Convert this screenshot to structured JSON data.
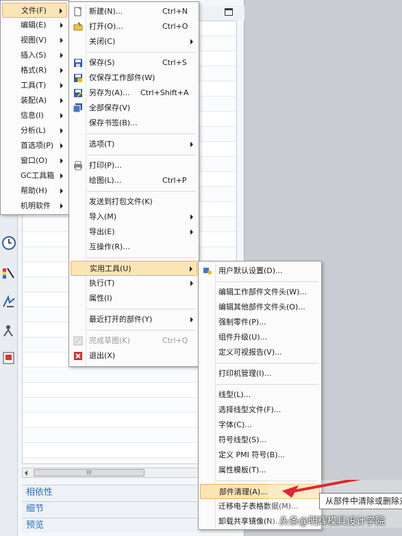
{
  "nav_panel": {
    "bottom_panels": [
      "相依性",
      "细节",
      "预览"
    ],
    "scroll_thumb": "III"
  },
  "main_menu": [
    {
      "label": "文件(F)",
      "active": true
    },
    {
      "label": "编辑(E)"
    },
    {
      "label": "视图(V)"
    },
    {
      "label": "插入(S)"
    },
    {
      "label": "格式(R)"
    },
    {
      "label": "工具(T)"
    },
    {
      "label": "装配(A)"
    },
    {
      "label": "信息(I)"
    },
    {
      "label": "分析(L)"
    },
    {
      "label": "首选项(P)"
    },
    {
      "label": "窗口(O)"
    },
    {
      "label": "GC工具箱"
    },
    {
      "label": "帮助(H)"
    },
    {
      "label": "机明软件"
    }
  ],
  "file_menu": [
    {
      "label": "新建(N)...",
      "shortcut": "Ctrl+N",
      "icon": "new-file-icon"
    },
    {
      "label": "打开(O)...",
      "shortcut": "Ctrl+O",
      "icon": "open-folder-icon"
    },
    {
      "label": "关闭(C)",
      "submenu": true
    },
    {
      "sep": true
    },
    {
      "label": "保存(S)",
      "shortcut": "Ctrl+S",
      "icon": "save-icon"
    },
    {
      "label": "仅保存工作部件(W)",
      "icon": "save-work-part-icon"
    },
    {
      "label": "另存为(A)...",
      "shortcut": "Ctrl+Shift+A",
      "icon": "save-as-icon"
    },
    {
      "label": "全部保存(V)",
      "icon": "save-all-icon"
    },
    {
      "label": "保存书签(B)..."
    },
    {
      "sep": true
    },
    {
      "label": "选项(T)",
      "submenu": true
    },
    {
      "sep": true
    },
    {
      "label": "打印(P)...",
      "icon": "print-icon"
    },
    {
      "label": "绘图(L)...",
      "shortcut": "Ctrl+P"
    },
    {
      "sep": true
    },
    {
      "label": "发送到打包文件(K)"
    },
    {
      "label": "导入(M)",
      "submenu": true
    },
    {
      "label": "导出(E)",
      "submenu": true
    },
    {
      "label": "互操作(R)..."
    },
    {
      "sep": true
    },
    {
      "label": "实用工具(U)",
      "submenu": true,
      "active": true
    },
    {
      "label": "执行(T)",
      "submenu": true
    },
    {
      "label": "属性(I)"
    },
    {
      "sep": true
    },
    {
      "label": "最近打开的部件(Y)",
      "submenu": true
    },
    {
      "sep": true
    },
    {
      "label": "完成草图(K)",
      "shortcut": "Ctrl+Q",
      "disabled": true,
      "icon": "finish-sketch-icon"
    },
    {
      "label": "退出(X)",
      "icon": "exit-icon"
    }
  ],
  "utilities_menu": [
    {
      "label": "用户默认设置(D)...",
      "icon": "user-defaults-icon"
    },
    {
      "sep": true
    },
    {
      "label": "编辑工作部件文件头(W)..."
    },
    {
      "label": "编辑其他部件文件头(O)..."
    },
    {
      "label": "强制零件(P)..."
    },
    {
      "label": "组件升级(U)..."
    },
    {
      "label": "定义可视报告(V)..."
    },
    {
      "sep": true
    },
    {
      "label": "打印机管理(I)..."
    },
    {
      "sep": true
    },
    {
      "label": "线型(L)..."
    },
    {
      "label": "选择线型文件(F)..."
    },
    {
      "label": "字体(C)..."
    },
    {
      "label": "符号线型(S)..."
    },
    {
      "label": "定义 PMI 符号(B)..."
    },
    {
      "label": "属性模板(T)..."
    },
    {
      "sep": true
    },
    {
      "label": "部件清理(A)...",
      "active": true
    },
    {
      "label": "迁移电子表格数据(M)..."
    },
    {
      "label": "卸载共享镜像(N)..."
    }
  ],
  "tooltip": "从部件中清除或删除对象",
  "watermark": {
    "text": "头条@明辉模具设计学院",
    "arrow_color": "#e0262e"
  },
  "colors": {
    "highlight_bg": "#fce5b4",
    "highlight_border": "#e8b454",
    "panel_text": "#2a6fb5"
  }
}
